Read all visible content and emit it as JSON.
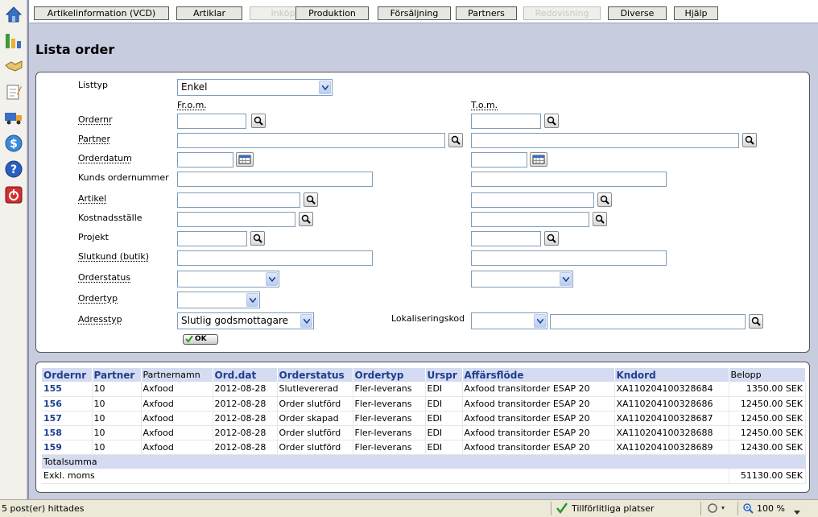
{
  "tabs": [
    {
      "label": "Artikelinformation (VCD)",
      "enabled": true
    },
    {
      "label": "Artiklar",
      "enabled": true
    },
    {
      "label": "Inköp",
      "enabled": false
    },
    {
      "label": "Produktion",
      "enabled": true
    },
    {
      "label": "Försäljning",
      "enabled": true
    },
    {
      "label": "Partners",
      "enabled": true
    },
    {
      "label": "Redovisning",
      "enabled": false
    },
    {
      "label": "Diverse",
      "enabled": true
    },
    {
      "label": "Hjälp",
      "enabled": true
    }
  ],
  "sidebar_icons": [
    "home-icon",
    "chart-icon",
    "handshake-icon",
    "notepad-icon",
    "truck-icon",
    "dollar-icon",
    "help-icon",
    "power-icon"
  ],
  "page_title": "Lista order",
  "form": {
    "listtyp_label": "Listtyp",
    "listtyp_value": "Enkel",
    "from_label": "Fr.o.m.",
    "tom_label": "T.o.m.",
    "ordernr_label": "Ordernr",
    "partner_label": "Partner",
    "orderdatum_label": "Orderdatum",
    "kunds_ordernummer_label": "Kunds ordernummer",
    "artikel_label": "Artikel",
    "kostnadsstalle_label": "Kostnadsställe",
    "projekt_label": "Projekt",
    "slutkund_label": "Slutkund (butik)",
    "orderstatus_label": "Orderstatus",
    "ordertyp_label": "Ordertyp",
    "adresstyp_label": "Adresstyp",
    "adresstyp_value": "Slutlig godsmottagare",
    "lokaliseringskod_label": "Lokaliseringskod",
    "ok_label": "OK"
  },
  "table": {
    "headers": [
      "Ordernr",
      "Partner",
      "Partnernamn",
      "Ord.dat",
      "Orderstatus",
      "Ordertyp",
      "Urspr",
      "Affärsflöde",
      "Kndord",
      "Belopp"
    ],
    "rows": [
      [
        "155",
        "10",
        "Axfood",
        "2012-08-28",
        "Slutlevererad",
        "Fler-leverans",
        "EDI",
        "Axfood transitorder ESAP 20",
        "XA110204100328684",
        "1350.00 SEK"
      ],
      [
        "156",
        "10",
        "Axfood",
        "2012-08-28",
        "Order slutförd",
        "Fler-leverans",
        "EDI",
        "Axfood transitorder ESAP 20",
        "XA110204100328686",
        "12450.00 SEK"
      ],
      [
        "157",
        "10",
        "Axfood",
        "2012-08-28",
        "Order skapad",
        "Fler-leverans",
        "EDI",
        "Axfood transitorder ESAP 20",
        "XA110204100328687",
        "12450.00 SEK"
      ],
      [
        "158",
        "10",
        "Axfood",
        "2012-08-28",
        "Order slutförd",
        "Fler-leverans",
        "EDI",
        "Axfood transitorder ESAP 20",
        "XA110204100328688",
        "12450.00 SEK"
      ],
      [
        "159",
        "10",
        "Axfood",
        "2012-08-28",
        "Order slutförd",
        "Fler-leverans",
        "EDI",
        "Axfood transitorder ESAP 20",
        "XA110204100328689",
        "12430.00 SEK"
      ]
    ],
    "totalsumma_label": "Totalsumma",
    "exkl_moms_label": "Exkl. moms",
    "exkl_moms_value": "51130.00 SEK"
  },
  "statusbar": {
    "left_text": "5 post(er) hittades",
    "zone_text": "Tillförlitliga platser",
    "zoom_text": "100 %"
  },
  "colors": {
    "background": "#c8ccdf",
    "header_blue": "#1d3f8f",
    "table_header_bg": "#d5dbf0"
  }
}
